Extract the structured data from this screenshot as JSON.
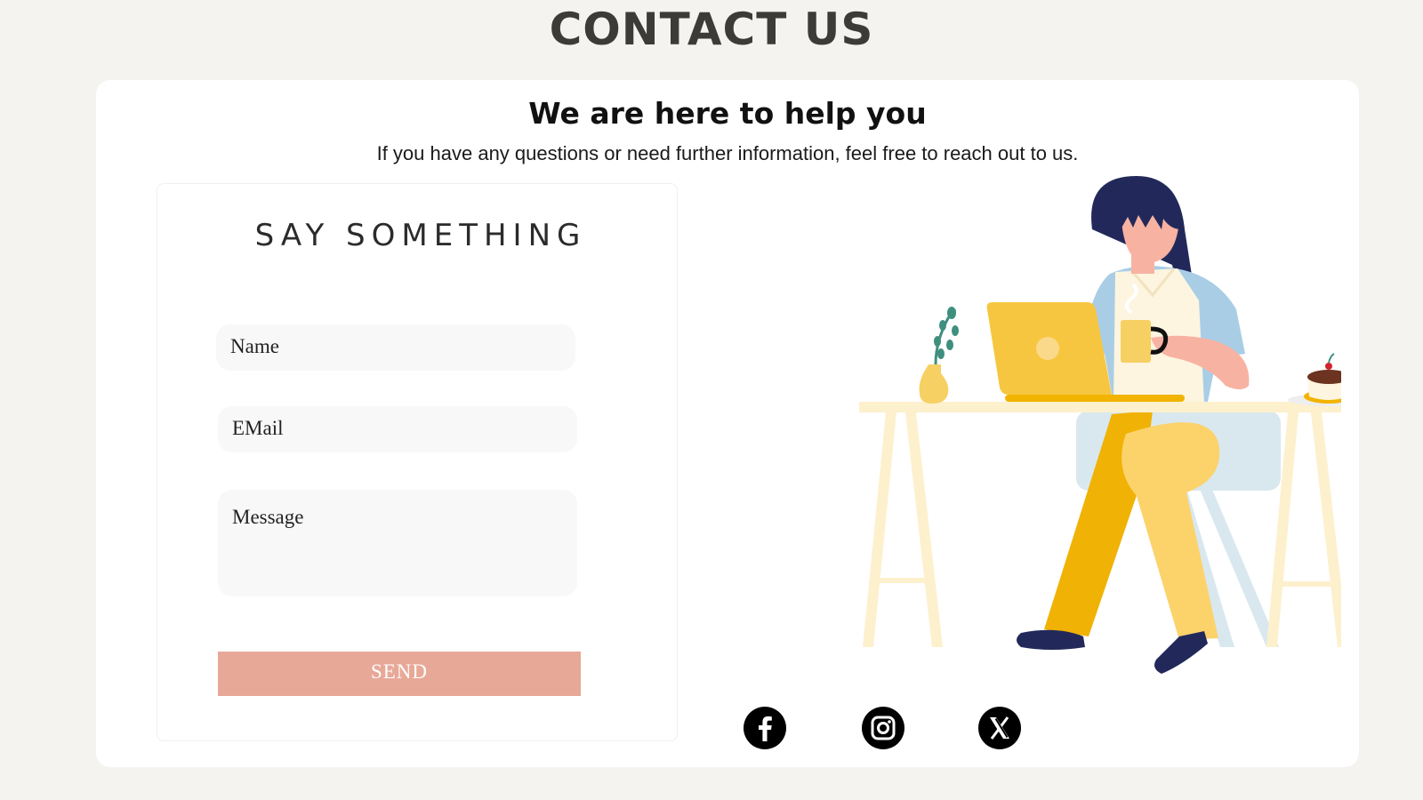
{
  "page": {
    "title": "CONTACT US"
  },
  "card": {
    "heading": "We are here to help you",
    "subheading": "If you have any questions or need further information, feel free to reach out to us."
  },
  "form": {
    "title": "SAY SOMETHING",
    "name_placeholder": "Name",
    "email_placeholder": "EMail",
    "message_placeholder": "Message",
    "send_label": "SEND"
  },
  "social": {
    "icons": [
      "facebook-icon",
      "instagram-icon",
      "x-icon"
    ]
  },
  "colors": {
    "background": "#f4f3ef",
    "card": "#ffffff",
    "title": "#3d3b38",
    "send_button": "#e8a898",
    "field": "#f8f8f8"
  }
}
